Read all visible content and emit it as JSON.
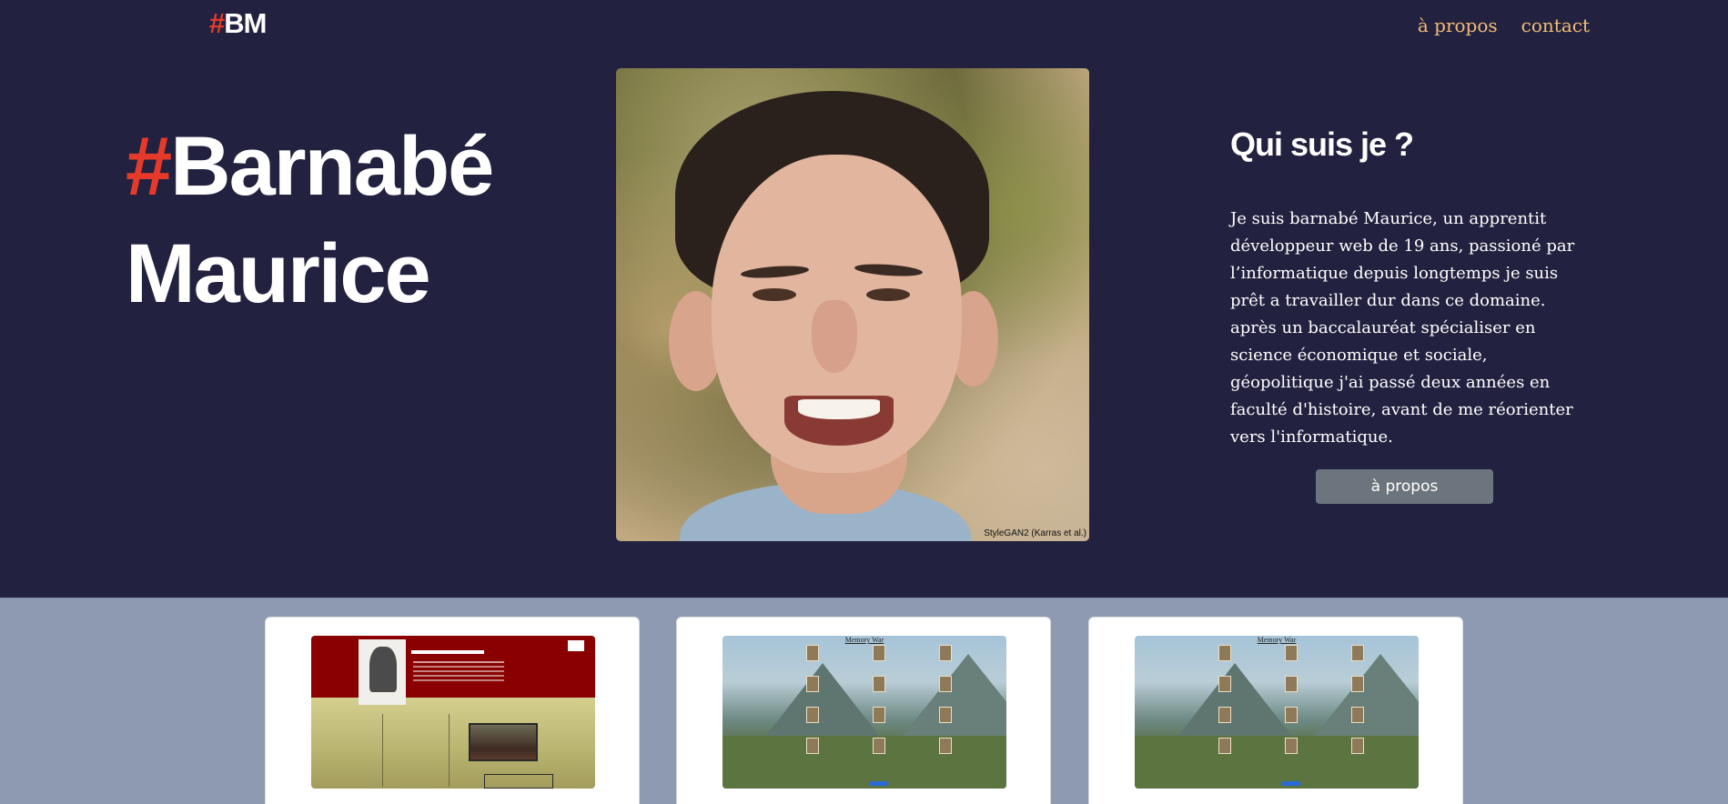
{
  "header": {
    "logo_hash": "#",
    "logo_letters": "BM",
    "nav": [
      {
        "label": "à propos"
      },
      {
        "label": "contact"
      }
    ]
  },
  "hero": {
    "name_hash": "#",
    "name_first": "Barnabé",
    "name_last": "Maurice",
    "portrait_credit": "StyleGAN2 (Karras et al.)",
    "about_title": "Qui suis je ?",
    "about_text": "Je suis barnabé Maurice, un apprentit développeur web de 19 ans, passioné par l’informatique depuis longtemps je suis prêt a travailler dur dans ce domaine. après un baccalauréat spécialiser en science économique et sociale, géopolitique j'ai passé deux années en faculté d'histoire, avant de me réorienter vers l'informatique.",
    "about_button": "à propos"
  },
  "projects": {
    "cards": [
      {
        "thumbnail": "western-site-screenshot"
      },
      {
        "thumbnail": "memory-game-screenshot",
        "mini_title": "Memory War"
      },
      {
        "thumbnail": "memory-game-screenshot",
        "mini_title": "Memory War"
      }
    ]
  },
  "colors": {
    "background": "#222240",
    "accent": "#e53a2a",
    "nav_link": "#f3bc74",
    "projects_bg": "#8d9ab1",
    "button": "#6c757d"
  }
}
